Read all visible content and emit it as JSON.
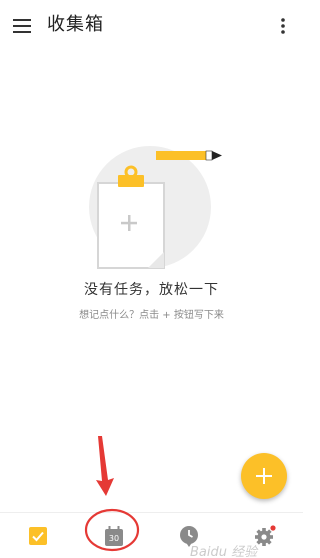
{
  "app_bar": {
    "title": "收集箱",
    "menu_icon": "hamburger-menu-icon",
    "more_icon": "more-vertical-icon"
  },
  "empty_state": {
    "title": "没有任务，放松一下",
    "hint": "想记点什么？点击 + 按钮写下来",
    "illustration_icon": "clipboard-pencil-illustration"
  },
  "fab": {
    "icon": "plus-icon",
    "color": "#fcc028"
  },
  "bottom_nav": {
    "items": [
      {
        "icon": "checkbox-tasks-icon",
        "active": true
      },
      {
        "icon": "calendar-icon",
        "day": "30",
        "active": false
      },
      {
        "icon": "clock-icon",
        "active": false
      },
      {
        "icon": "settings-gear-icon",
        "active": false,
        "badge": true
      }
    ]
  },
  "annotation": {
    "arrow_color": "#e53935",
    "circle_color": "#e53935"
  },
  "watermark": {
    "text": "Baidu 经验"
  },
  "colors": {
    "accent": "#fcc028",
    "icon_gray": "#8a8a8a",
    "badge_red": "#e53935"
  }
}
